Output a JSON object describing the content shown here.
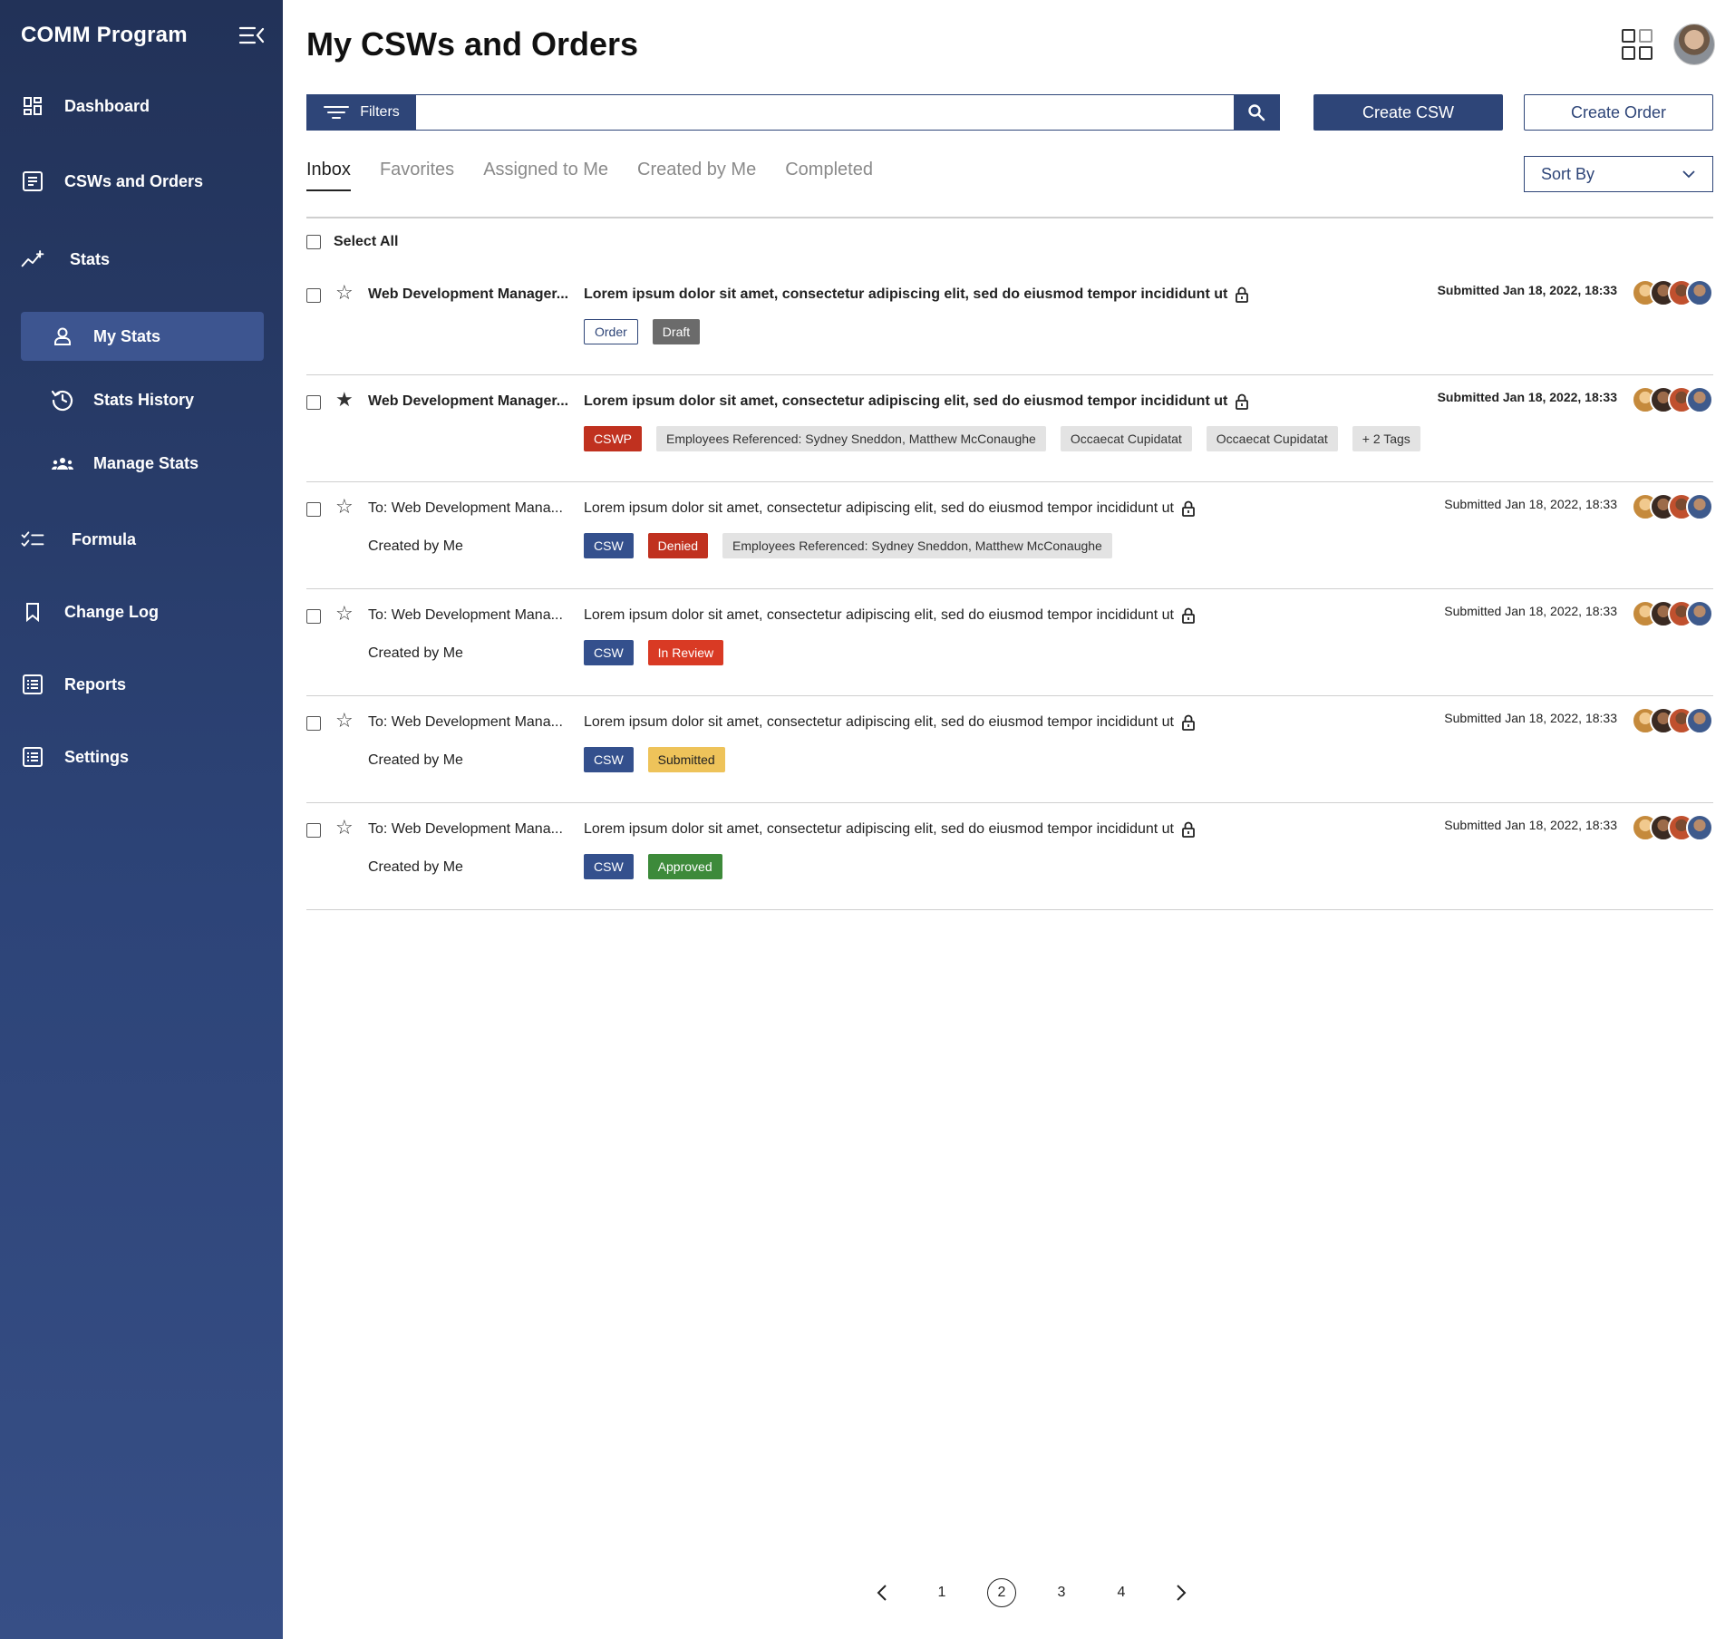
{
  "sidebar": {
    "title": "COMM Program",
    "items": [
      {
        "label": "Dashboard"
      },
      {
        "label": "CSWs and  Orders"
      },
      {
        "label": "Stats"
      },
      {
        "label": "Formula"
      },
      {
        "label": "Change Log"
      },
      {
        "label": "Reports"
      },
      {
        "label": "Settings"
      }
    ],
    "stats_sub": [
      {
        "label": "My Stats"
      },
      {
        "label": "Stats History"
      },
      {
        "label": "Manage Stats"
      }
    ]
  },
  "header": {
    "title": "My CSWs and Orders",
    "filters_label": "Filters",
    "search_placeholder": "",
    "create_csw": "Create CSW",
    "create_order": "Create Order",
    "sort_by": "Sort By"
  },
  "tabs": [
    "Inbox",
    "Favorites",
    "Assigned to Me",
    "Created by Me",
    "Completed"
  ],
  "select_all": "Select All",
  "rows": [
    {
      "subject": "Web Development Manager...",
      "sub2": "",
      "desc": "Lorem ipsum dolor sit amet, consectetur adipiscing elit, sed do eiusmod tempor incididunt ut",
      "date": "Submitted Jan 18, 2022, 18:33",
      "tags": [
        "Order",
        "Draft"
      ],
      "starred": false
    },
    {
      "subject": "Web Development Manager...",
      "sub2": "",
      "desc": "Lorem ipsum dolor sit amet, consectetur adipiscing elit, sed do eiusmod tempor incididunt ut",
      "date": "Submitted Jan 18, 2022, 18:33",
      "tags": [
        "CSWP",
        "Employees Referenced: Sydney Sneddon, Matthew McConaughe",
        "Occaecat Cupidatat",
        "Occaecat Cupidatat",
        "+ 2 Tags"
      ],
      "starred": true
    },
    {
      "subject": "To: Web Development Mana...",
      "sub2": "Created by Me",
      "desc": "Lorem ipsum dolor sit amet, consectetur adipiscing elit, sed do eiusmod tempor incididunt ut",
      "date": "Submitted Jan 18, 2022, 18:33",
      "tags": [
        "CSW",
        "Denied",
        "Employees Referenced: Sydney Sneddon, Matthew McConaughe"
      ],
      "starred": false
    },
    {
      "subject": "To: Web Development Mana...",
      "sub2": "Created by Me",
      "desc": "Lorem ipsum dolor sit amet, consectetur adipiscing elit, sed do eiusmod tempor incididunt ut",
      "date": "Submitted Jan 18, 2022, 18:33",
      "tags": [
        "CSW",
        "In Review"
      ],
      "starred": false
    },
    {
      "subject": "To: Web Development Mana...",
      "sub2": "Created by Me",
      "desc": "Lorem ipsum dolor sit amet, consectetur adipiscing elit, sed do eiusmod tempor incididunt ut",
      "date": "Submitted Jan 18, 2022, 18:33",
      "tags": [
        "CSW",
        "Submitted"
      ],
      "starred": false
    },
    {
      "subject": "To: Web Development Mana...",
      "sub2": "Created by Me",
      "desc": "Lorem ipsum dolor sit amet, consectetur adipiscing elit, sed do eiusmod tempor incididunt ut",
      "date": "Submitted Jan 18, 2022, 18:33",
      "tags": [
        "CSW",
        "Approved"
      ],
      "starred": false
    }
  ],
  "pagination": {
    "pages": [
      "1",
      "2",
      "3",
      "4"
    ],
    "current": "2"
  },
  "colors": {
    "sidebar": "#2d4478",
    "accent": "#2e4578",
    "denied": "#c0311f",
    "review": "#d93a24",
    "submitted": "#eec35a",
    "approved": "#3d8a3a"
  }
}
